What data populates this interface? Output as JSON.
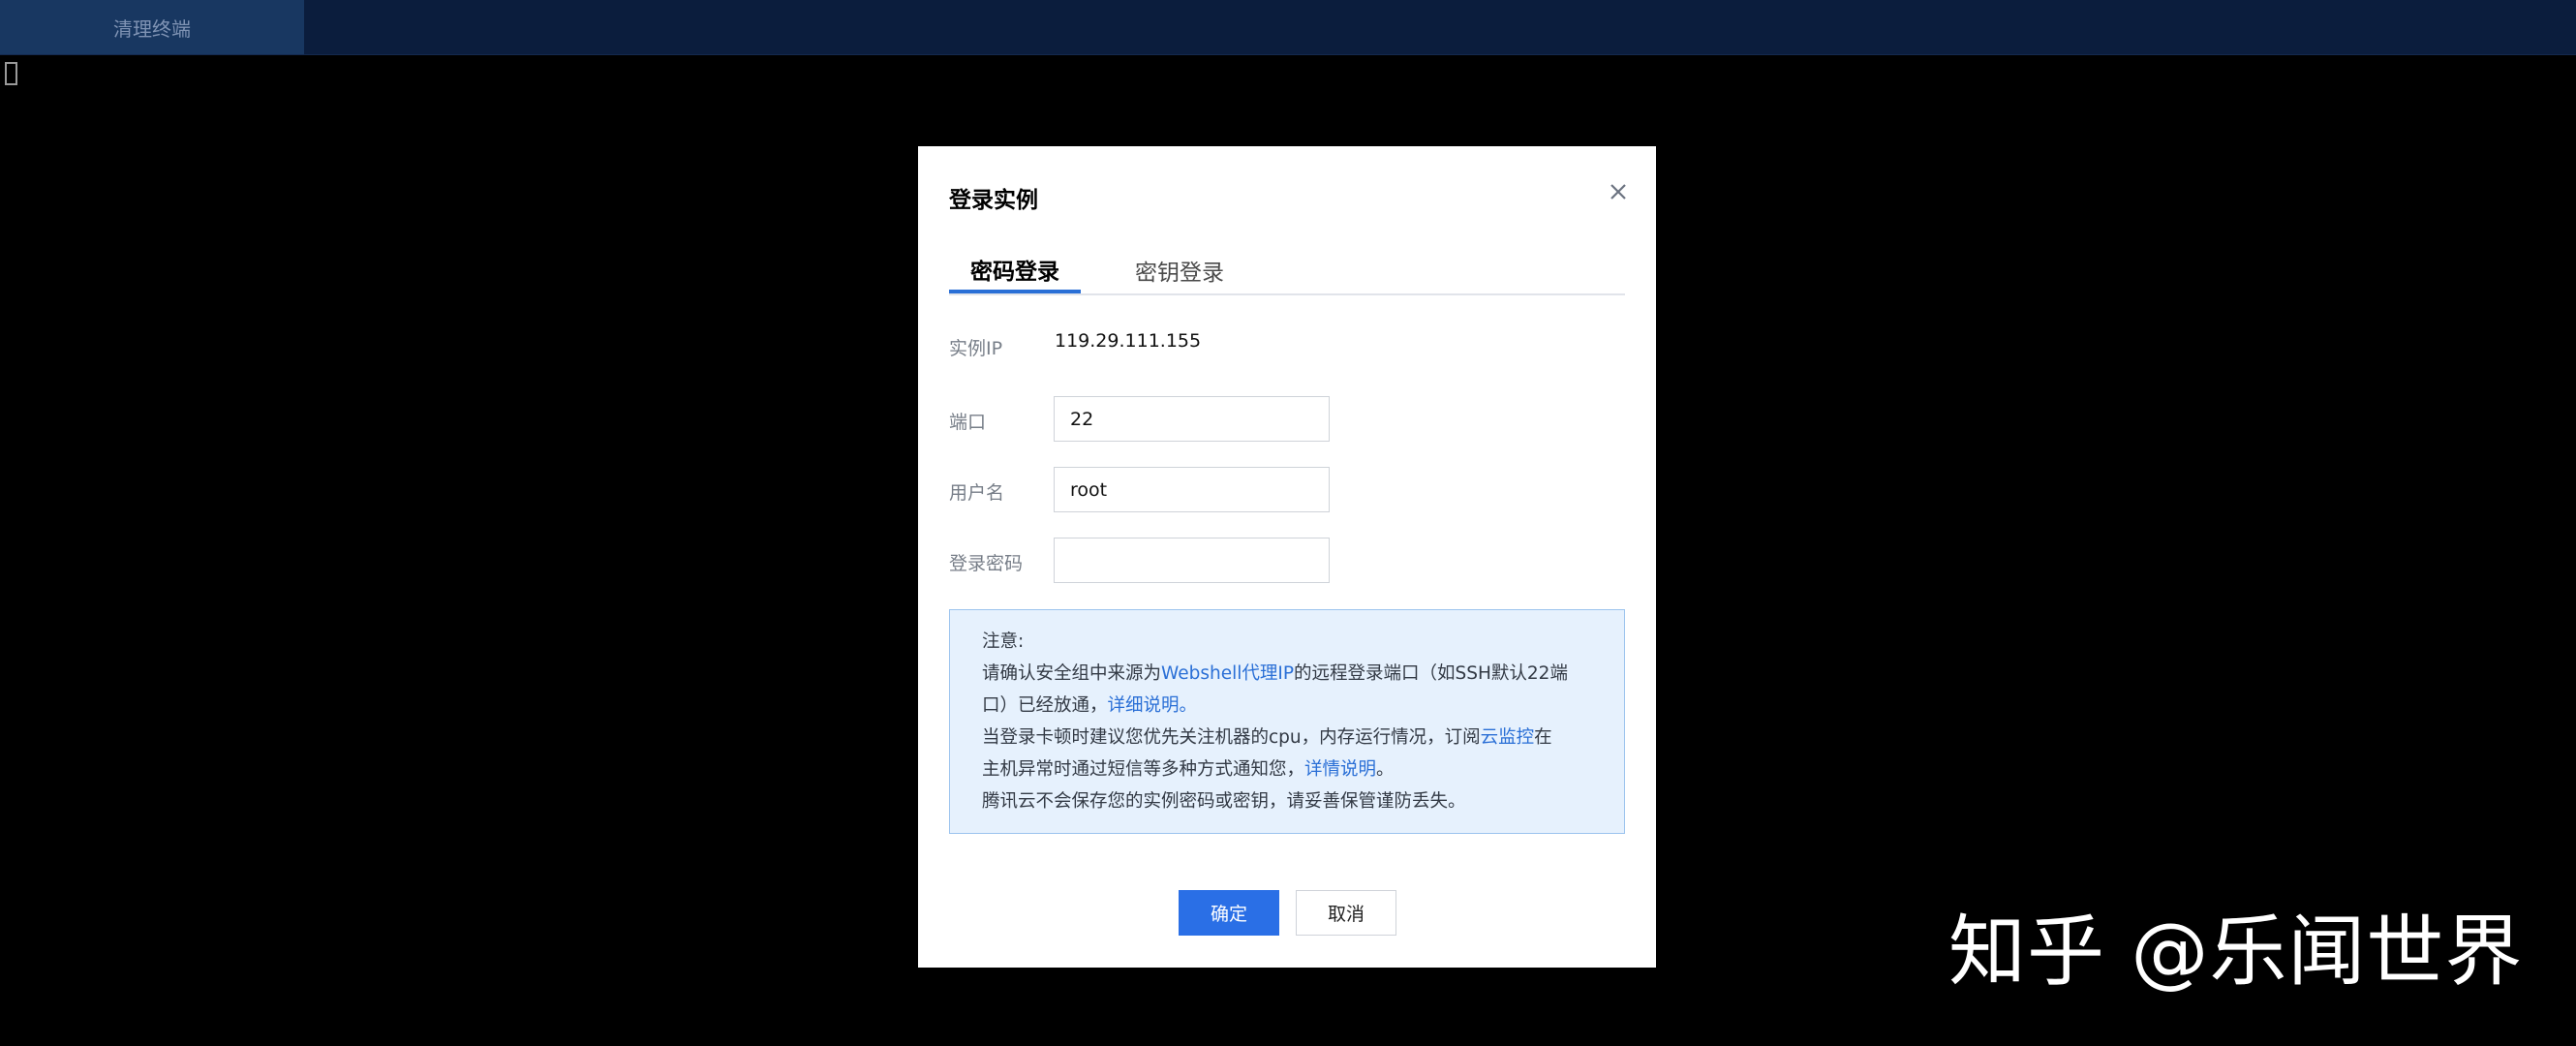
{
  "topbar": {
    "tab_label": "清理终端"
  },
  "dialog": {
    "title": "登录实例",
    "tabs": [
      {
        "label": "密码登录",
        "active": true
      },
      {
        "label": "密钥登录",
        "active": false
      }
    ],
    "form": {
      "ip_label": "实例IP",
      "ip_value": "119.29.111.155",
      "port_label": "端口",
      "port_value": "22",
      "username_label": "用户名",
      "username_value": "root",
      "password_label": "登录密码",
      "password_value": ""
    },
    "notice": {
      "heading": "注意:",
      "l1_a": "请确认安全组中来源为",
      "l1_link": "Webshell代理IP",
      "l1_b": "的远程登录端口（如SSH默认22端",
      "l2_a": "口）已经放通，",
      "l2_link": "详细说明。",
      "l3_a": "当登录卡顿时建议您优先关注机器的cpu，内存运行情况，订阅",
      "l3_link": "云监控",
      "l3_b": "在",
      "l4_a": "主机异常时通过短信等多种方式通知您，",
      "l4_link": "详情说明",
      "l4_b": "。",
      "l5": "腾讯云不会保存您的实例密码或密钥，请妥善保管谨防丢失。"
    },
    "buttons": {
      "confirm": "确定",
      "cancel": "取消"
    }
  },
  "watermark": "知乎 @乐闻世界",
  "colors": {
    "accent": "#2a6fe6",
    "topbar": "#0b1d3d",
    "notice_bg": "#e6f1fd"
  }
}
